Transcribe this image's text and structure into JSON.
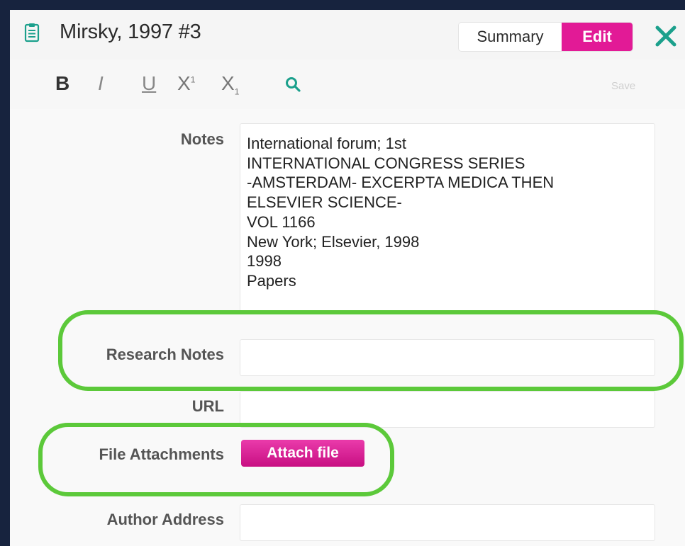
{
  "header": {
    "title": "Mirsky, 1997 #3",
    "icon": "clipboard-icon",
    "tabs": {
      "summary_label": "Summary",
      "edit_label": "Edit"
    },
    "close_icon": "close-icon",
    "accent_color": "#e21a96",
    "close_color": "#1ba08c"
  },
  "toolbar": {
    "bold_label": "B",
    "italic_label": "I",
    "underline_label": "U",
    "superscript_label": "X",
    "superscript_mark": "1",
    "subscript_label": "X",
    "subscript_mark": "1",
    "search_icon": "search-icon",
    "save_label": "Save"
  },
  "form": {
    "notes": {
      "label": "Notes",
      "lines": [
        "International forum; 1st",
        "INTERNATIONAL CONGRESS SERIES",
        "-AMSTERDAM- EXCERPTA MEDICA THEN",
        "ELSEVIER SCIENCE-",
        "VOL 1166",
        "New York; Elsevier, 1998",
        "1998",
        "Papers"
      ]
    },
    "research_notes": {
      "label": "Research Notes",
      "value": ""
    },
    "url": {
      "label": "URL",
      "value": ""
    },
    "file_attachments": {
      "label": "File Attachments",
      "button_label": "Attach file"
    },
    "author_address": {
      "label": "Author Address",
      "value": ""
    }
  },
  "highlight_color": "#5cc93a"
}
